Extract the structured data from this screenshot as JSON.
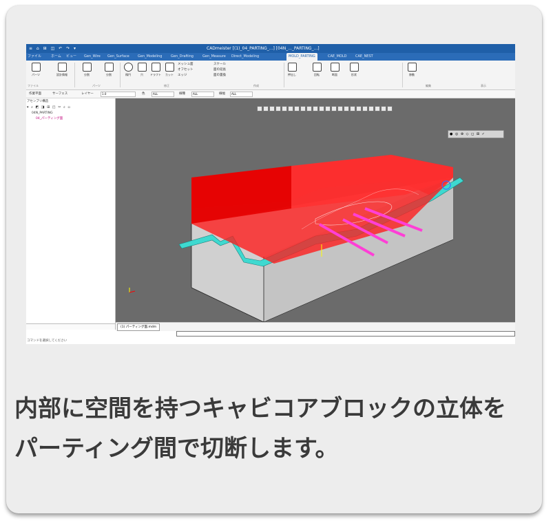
{
  "app": {
    "quick_access": "≡ ⌂ ⊞ ◫ ↶ ↷ ▾",
    "title": "CADmeister  [(1)_04_PARTING_...]  [04N_..._PARTING_...]"
  },
  "tabs": [
    "ファイル",
    "ホーム",
    "ビュー",
    "Gen_Wire",
    "Gen_Surface",
    "Gen_Modeling",
    "Gen_Drafting",
    "Gen_Measure",
    "Direct_Modeling",
    "MOLD_PARTING",
    "CAE_MOLD",
    "CAE_NEST"
  ],
  "ribbon": {
    "buttons": [
      "パーツ",
      "設計情報",
      "分割",
      "分割",
      "楕円",
      "穴",
      "ドラフト",
      "カット",
      "押出し",
      "回転",
      "断面",
      "形状",
      "移動"
    ],
    "small_items": [
      "メッシュ面",
      "オフセット",
      "エッジ",
      "スケール",
      "面の延長",
      "面の置換"
    ],
    "groups": [
      "ファイル",
      "パーツ",
      "修正",
      "作成",
      "編集",
      "表示"
    ]
  },
  "options_bar": {
    "labels": [
      "作業平面",
      "サーフェス",
      "レイヤー",
      "色",
      "線種",
      "線幅"
    ],
    "fields": [
      "1.0",
      "ALL",
      "ALL",
      "ALL"
    ]
  },
  "tree": {
    "header": "アセンブリ構造",
    "toolbar_icons": "▾ ⌕ ◩ ◨ ⊞ ◰ ✂ ⌕ ▫",
    "root": "04N_PARTING",
    "child": "04_パーティング面"
  },
  "viewport": {
    "toolbar_icons_count": 22,
    "minitoolbar": "● ◎ ⊕ ◇ ◻ ⊞ ✓"
  },
  "document_tab": "(1) パーティング面.mdm",
  "status": "コマンドを選択してください",
  "caption": {
    "line1": "内部に空間を持つキャビコアブロックの立体を",
    "line2": "パーティング間で切断します。"
  },
  "colors": {
    "title_bar": "#1f5fa8",
    "viewport_bg": "#6b6b6b",
    "block_red": "#ff1a1a",
    "parting_cyan": "#3ed9d0",
    "rib_magenta": "#ff3fd6",
    "gray_block": "#cfcfcf"
  }
}
